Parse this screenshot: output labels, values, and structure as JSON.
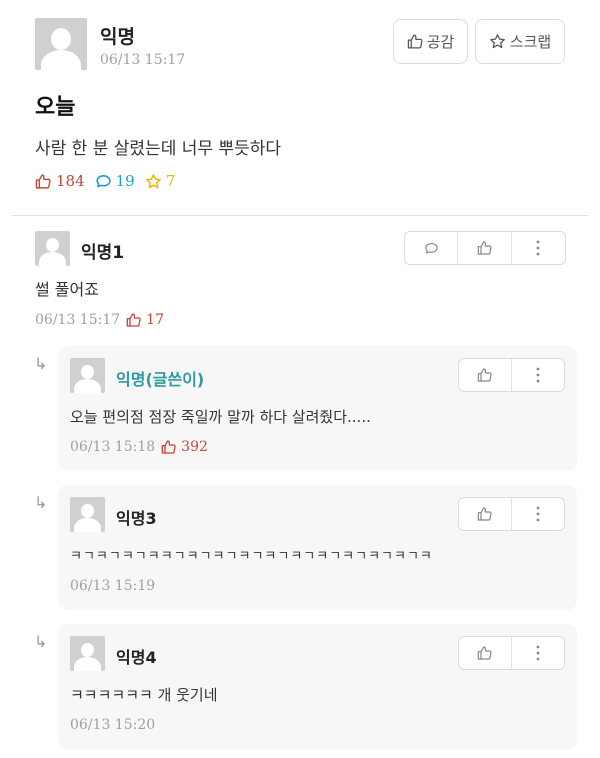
{
  "post": {
    "author": "익명",
    "date": "06/13 15:17",
    "title": "오늘",
    "body": "사람 한 분 살렸는데 너무 뿌듯하다",
    "actions": {
      "empathy_label": "공감",
      "scrap_label": "스크랩"
    },
    "stats": {
      "likes": "184",
      "comments": "19",
      "scraps": "7"
    }
  },
  "comments": [
    {
      "author": "익명1",
      "body": "썰 풀어죠",
      "date": "06/13 15:17",
      "likes": "17"
    }
  ],
  "replies": [
    {
      "author": "익명(글쓴이)",
      "body": "오늘 편의점 점장 죽일까 말까 하다 살려줬다.....",
      "date": "06/13 15:18",
      "likes": "392",
      "author_color": "#2f9aa0"
    },
    {
      "author": "익명3",
      "body": "ㅋㄱㅋㄱㅋㄱㅋㅋㄱㅋㄱㅋㄱㅋㄱㅋㄱㅋㄱㅋㄱㅋㄱㅋㄱㅋㄱㅋ",
      "date": "06/13 15:19"
    },
    {
      "author": "익명4",
      "body": "ㅋㅋㅋㅋㅋㅋ 개 웃기네",
      "date": "06/13 15:20"
    }
  ],
  "colors": {
    "like": "#c6463a",
    "comment": "#1a9ec9",
    "scrap": "#e8b400",
    "op_author": "#2f9aa0"
  }
}
